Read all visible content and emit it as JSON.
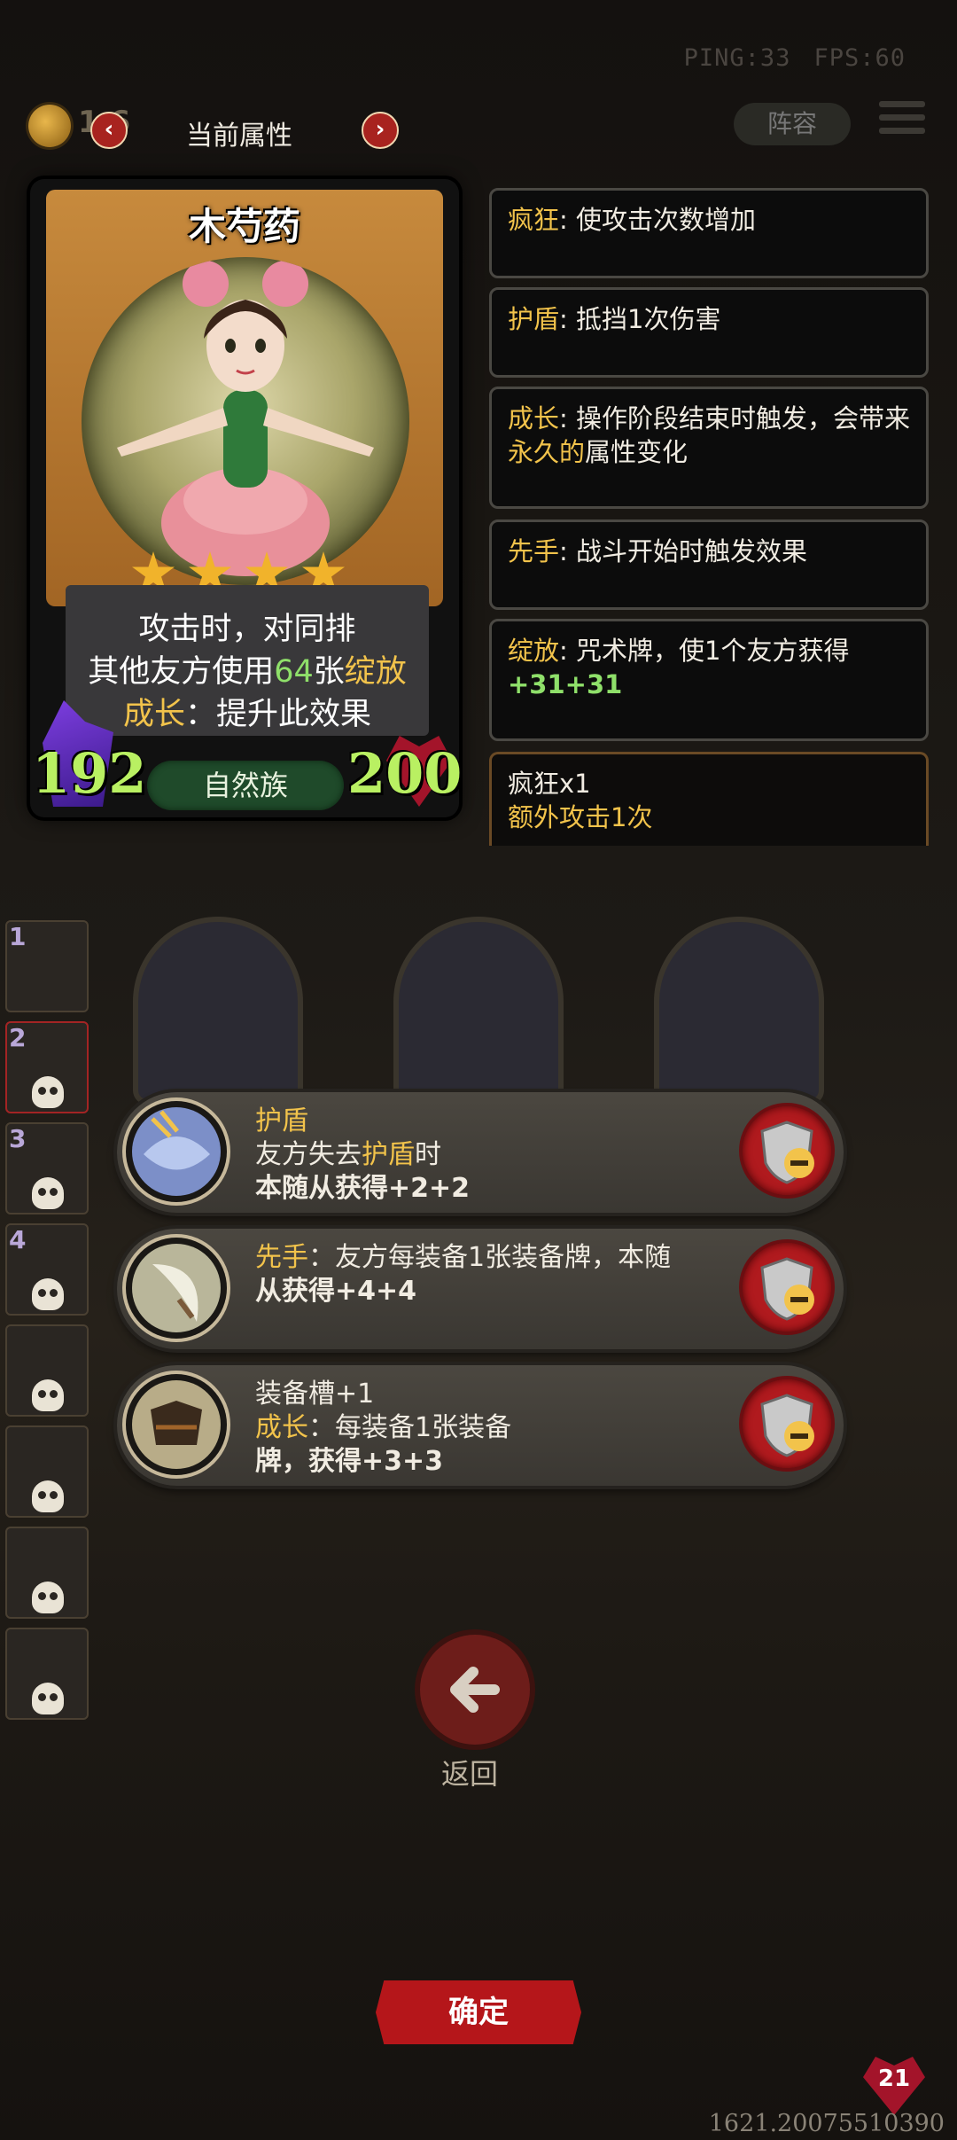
{
  "hud": {
    "ping": "PING:33",
    "fps": "FPS:60"
  },
  "top": {
    "coins": "1 6",
    "title": "当前属性",
    "team_label": "阵容"
  },
  "card": {
    "name": "木芍药",
    "stars": 4,
    "desc_line1": "攻击时，对同排",
    "desc_line2_a": "其他友方使用",
    "desc_line2_num": "64",
    "desc_line2_b": "张",
    "desc_line2_kw": "绽放",
    "desc_line3_kw": "成长",
    "desc_line3_b": "：提升此效果",
    "attack": "192",
    "tribe": "自然族",
    "health": "200"
  },
  "keywords": [
    {
      "key": "疯狂",
      "text": ": 使攻击次数增加"
    },
    {
      "key": "护盾",
      "text": ": 抵挡1次伤害"
    },
    {
      "key": "成长",
      "text": ": 操作阶段结束时触发，会带来",
      "key2": "永久的",
      "text2": "属性变化"
    },
    {
      "key": "先手",
      "text": ": 战斗开始时触发效果"
    },
    {
      "key": "绽放",
      "text": ": 咒术牌，使1个友方获得",
      "green": "+31+31"
    }
  ],
  "buff": {
    "line1": "疯狂x1",
    "line2": "额外攻击1次"
  },
  "side_slots": [
    "1",
    "2",
    "3",
    "4",
    "",
    "",
    "",
    ""
  ],
  "effects": [
    {
      "line1_kw": "护盾",
      "line2_a": "友方失去",
      "line2_kw": "护盾",
      "line2_b": "时",
      "line3": "本随从获得+2+2"
    },
    {
      "line1_kw": "先手",
      "line1_b": "：友方每装备1张装备牌，本随",
      "line2": "从获得+4+4"
    },
    {
      "line1": "装备槽+1",
      "line2_kw": "成长",
      "line2_b": "：每装备1张装备",
      "line3": "牌，获得+3+3"
    }
  ],
  "back_label": "返回",
  "confirm_label": "确定",
  "hero_health": "21",
  "coords": "1621.20075510390",
  "colors": {
    "keyword": "#f2c34b",
    "green": "#8fe06a",
    "button_red": "#b5161a"
  }
}
